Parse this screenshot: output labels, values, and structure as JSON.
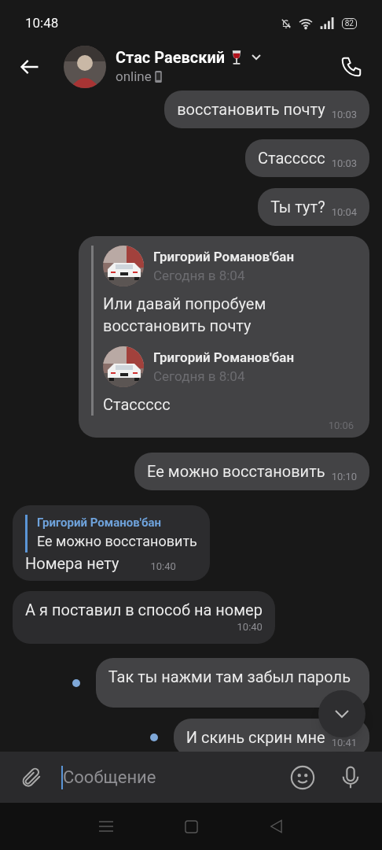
{
  "status_bar": {
    "time": "10:48",
    "battery": "82"
  },
  "header": {
    "name": "Стас Раевский",
    "status": "online"
  },
  "messages": [
    {
      "kind": "text",
      "outgoing": true,
      "text": "восстановить почту",
      "time": "10:03",
      "unread": false
    },
    {
      "kind": "text",
      "outgoing": true,
      "text": "Стассссс",
      "time": "10:03",
      "unread": false
    },
    {
      "kind": "text",
      "outgoing": true,
      "text": "Ты тут?",
      "time": "10:04",
      "unread": false
    },
    {
      "kind": "forwarded",
      "outgoing": true,
      "time": "10:06",
      "unread": false,
      "forwards": [
        {
          "author": "Григорий Романов'бан",
          "date": "Сегодня в 8:04",
          "text": "Или давай попробуем восстановить почту"
        },
        {
          "author": "Григорий Романов'бан",
          "date": "Сегодня в 8:04",
          "text": "Стассссс"
        }
      ]
    },
    {
      "kind": "text",
      "outgoing": true,
      "text": "Ее можно восстановить",
      "time": "10:10",
      "unread": false
    },
    {
      "kind": "reply",
      "outgoing": false,
      "reply_author": "Григорий Романов'бан",
      "reply_text": "Ее можно восстановить",
      "text": "Номера нету",
      "time": "10:40",
      "unread": false
    },
    {
      "kind": "text",
      "outgoing": false,
      "text": "А я поставил в способ на номер",
      "time": "10:40",
      "unread": false
    },
    {
      "kind": "text",
      "outgoing": true,
      "text": "Так ты нажми там забыл пароль",
      "unread": true
    },
    {
      "kind": "text",
      "outgoing": true,
      "text": "И скинь скрин мне",
      "time": "10:41",
      "unread": true
    }
  ],
  "composer": {
    "placeholder": "Сообщение"
  }
}
